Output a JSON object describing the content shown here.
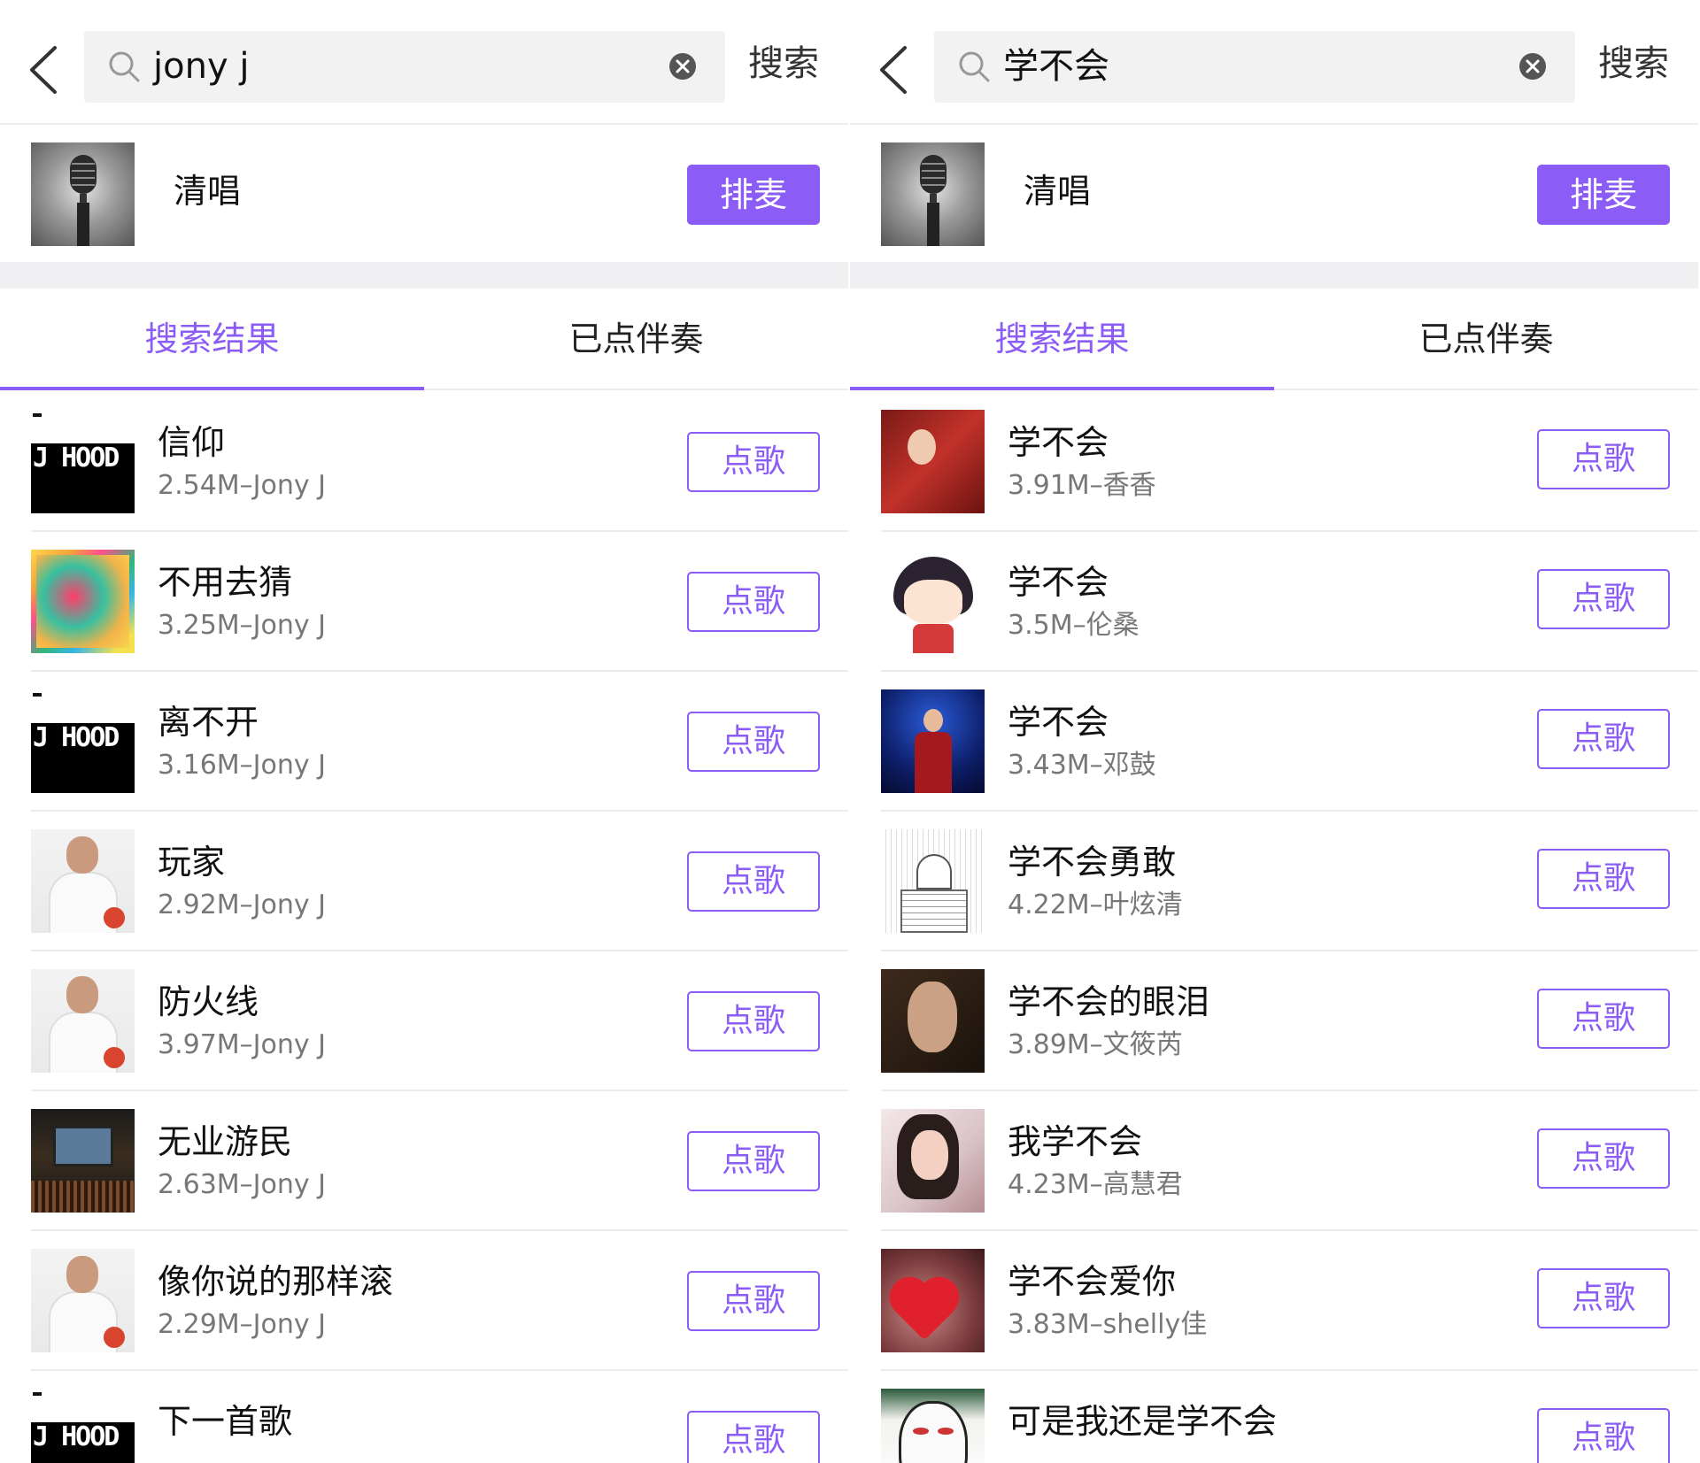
{
  "panels": [
    {
      "search": {
        "query": "jony j",
        "button": "搜索"
      },
      "acappella": {
        "title": "清唱",
        "button": "排麦"
      },
      "tabs": [
        {
          "label": "搜索结果"
        },
        {
          "label": "已点伴奏"
        }
      ],
      "songs": [
        {
          "title": "信仰",
          "meta": "2.54M–Jony J",
          "button": "点歌"
        },
        {
          "title": "不用去猜",
          "meta": "3.25M–Jony J",
          "button": "点歌"
        },
        {
          "title": "离不开",
          "meta": "3.16M–Jony J",
          "button": "点歌"
        },
        {
          "title": "玩家",
          "meta": "2.92M–Jony J",
          "button": "点歌"
        },
        {
          "title": "防火线",
          "meta": "3.97M–Jony J",
          "button": "点歌"
        },
        {
          "title": "无业游民",
          "meta": "2.63M–Jony J",
          "button": "点歌"
        },
        {
          "title": "像你说的那样滚",
          "meta": "2.29M–Jony J",
          "button": "点歌"
        },
        {
          "title": "下一首歌",
          "meta": "",
          "button": "点歌"
        }
      ]
    },
    {
      "search": {
        "query": "学不会",
        "button": "搜索"
      },
      "acappella": {
        "title": "清唱",
        "button": "排麦"
      },
      "tabs": [
        {
          "label": "搜索结果"
        },
        {
          "label": "已点伴奏"
        }
      ],
      "songs": [
        {
          "title": "学不会",
          "meta": "3.91M–香香",
          "button": "点歌"
        },
        {
          "title": "学不会",
          "meta": "3.5M–伦桑",
          "button": "点歌"
        },
        {
          "title": "学不会",
          "meta": "3.43M–邓鼓",
          "button": "点歌"
        },
        {
          "title": "学不会勇敢",
          "meta": "4.22M–叶炫清",
          "button": "点歌"
        },
        {
          "title": "学不会的眼泪",
          "meta": "3.89M–文筱芮",
          "button": "点歌"
        },
        {
          "title": "我学不会",
          "meta": "4.23M–高慧君",
          "button": "点歌"
        },
        {
          "title": "学不会爱你",
          "meta": "3.83M–shelly佳",
          "button": "点歌"
        },
        {
          "title": "可是我还是学不会",
          "meta": "",
          "button": "点歌"
        }
      ]
    }
  ],
  "cover_art": {
    "jhood_text": "J HOOD"
  },
  "colors": {
    "accent": "#8b5cf6",
    "divider": "#ececec",
    "search_bg": "#f2f2f2"
  },
  "icons": [
    "back-arrow-icon",
    "search-icon",
    "clear-icon",
    "microphone-icon"
  ]
}
